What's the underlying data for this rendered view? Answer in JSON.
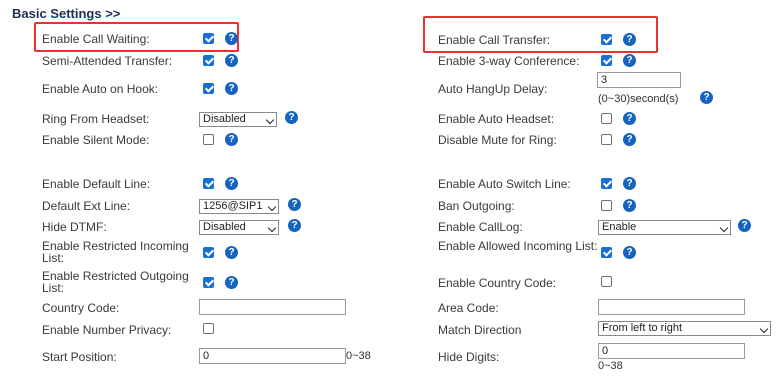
{
  "section_title": "Basic Settings >>",
  "help_glyph": "?",
  "colors": {
    "accent": "#1670d8",
    "help": "#1664c0",
    "highlight": "#e8322f",
    "title": "#1f2f52"
  },
  "left": {
    "call_waiting": {
      "label": "Enable Call Waiting:",
      "checked": true
    },
    "semi_attended": {
      "label": "Semi-Attended Transfer:",
      "checked": true
    },
    "auto_on_hook": {
      "label": "Enable Auto on Hook:",
      "checked": true
    },
    "ring_headset": {
      "label": "Ring From Headset:",
      "value": "Disabled"
    },
    "silent_mode": {
      "label": "Enable Silent Mode:",
      "checked": false
    },
    "default_line": {
      "label": "Enable Default Line:",
      "checked": true
    },
    "default_ext": {
      "label": "Default Ext Line:",
      "value": "1256@SIP1"
    },
    "hide_dtmf": {
      "label": "Hide DTMF:",
      "value": "Disabled"
    },
    "restricted_incoming": {
      "label": "Enable Restricted Incoming List:",
      "checked": true
    },
    "restricted_outgoing": {
      "label": "Enable Restricted Outgoing List:",
      "checked": true
    },
    "country_code": {
      "label": "Country Code:",
      "value": ""
    },
    "number_privacy": {
      "label": "Enable Number Privacy:",
      "checked": false
    },
    "start_position": {
      "label": "Start Position:",
      "value": "0",
      "range": "0~38"
    }
  },
  "right": {
    "call_transfer": {
      "label": "Enable Call Transfer:",
      "checked": true
    },
    "three_way": {
      "label": "Enable 3-way Conference:",
      "checked": true
    },
    "auto_hangup": {
      "label": "Auto HangUp Delay:",
      "value": "3",
      "range": "(0~30)second(s)"
    },
    "auto_headset": {
      "label": "Enable Auto Headset:",
      "checked": false
    },
    "mute_ring": {
      "label": "Disable Mute for Ring:",
      "checked": false
    },
    "auto_switch": {
      "label": "Enable Auto Switch Line:",
      "checked": true
    },
    "ban_outgoing": {
      "label": "Ban Outgoing:",
      "checked": false
    },
    "calllog": {
      "label": "Enable CallLog:",
      "value": "Enable"
    },
    "allowed_incoming": {
      "label": "Enable Allowed Incoming List:",
      "checked": true
    },
    "country_code_enable": {
      "label": "Enable Country Code:",
      "checked": false
    },
    "area_code": {
      "label": "Area Code:",
      "value": ""
    },
    "match_direction": {
      "label": "Match Direction",
      "value": "From left to right"
    },
    "hide_digits": {
      "label": "Hide Digits:",
      "value": "0",
      "range": "0~38"
    }
  }
}
